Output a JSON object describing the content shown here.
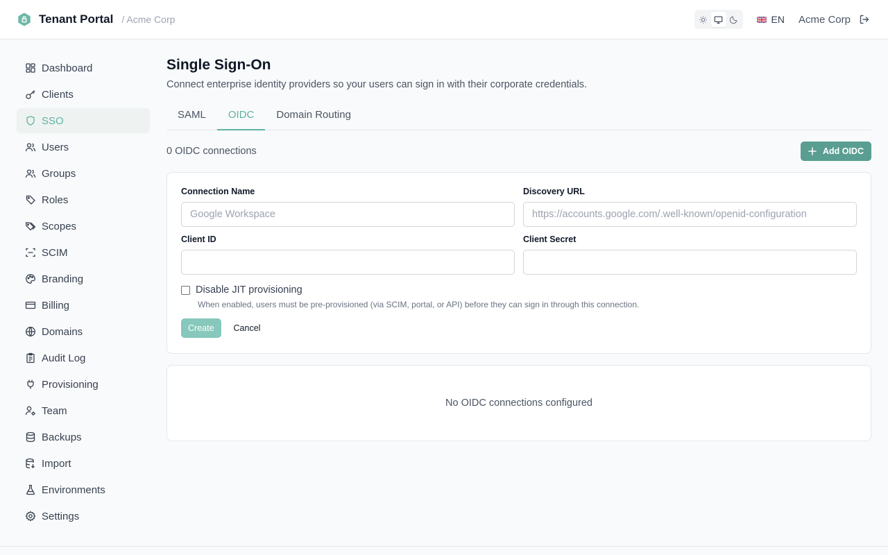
{
  "header": {
    "app_name": "Tenant Portal",
    "tenant_crumb": "/ Acme Corp",
    "language": "EN",
    "tenant_name": "Acme Corp",
    "accent": "#5fb3a3"
  },
  "sidebar": {
    "items": [
      {
        "label": "Dashboard",
        "icon": "dashboard-icon"
      },
      {
        "label": "Clients",
        "icon": "key-icon"
      },
      {
        "label": "SSO",
        "icon": "shield-icon",
        "active": true
      },
      {
        "label": "Users",
        "icon": "users-icon"
      },
      {
        "label": "Groups",
        "icon": "groups-icon"
      },
      {
        "label": "Roles",
        "icon": "tag-icon"
      },
      {
        "label": "Scopes",
        "icon": "tags-icon"
      },
      {
        "label": "SCIM",
        "icon": "scan-icon"
      },
      {
        "label": "Branding",
        "icon": "palette-icon"
      },
      {
        "label": "Billing",
        "icon": "credit-card-icon"
      },
      {
        "label": "Domains",
        "icon": "globe-icon"
      },
      {
        "label": "Audit Log",
        "icon": "clipboard-icon"
      },
      {
        "label": "Provisioning",
        "icon": "plug-icon"
      },
      {
        "label": "Team",
        "icon": "user-cog-icon"
      },
      {
        "label": "Backups",
        "icon": "database-icon"
      },
      {
        "label": "Import",
        "icon": "database-import-icon"
      },
      {
        "label": "Environments",
        "icon": "flask-icon"
      },
      {
        "label": "Settings",
        "icon": "gear-icon"
      }
    ]
  },
  "main": {
    "title": "Single Sign-On",
    "description": "Connect enterprise identity providers so your users can sign in with their corporate credentials.",
    "tabs": [
      {
        "label": "SAML"
      },
      {
        "label": "OIDC",
        "active": true
      },
      {
        "label": "Domain Routing"
      }
    ],
    "connection_count": "0 OIDC connections",
    "add_button": "Add OIDC",
    "form": {
      "name_label": "Connection Name",
      "name_placeholder": "Google Workspace",
      "name_value": "",
      "discovery_label": "Discovery URL",
      "discovery_placeholder": "https://accounts.google.com/.well-known/openid-configuration",
      "discovery_value": "",
      "client_id_label": "Client ID",
      "client_id_value": "",
      "client_secret_label": "Client Secret",
      "client_secret_value": "",
      "jit_label": "Disable JIT provisioning",
      "jit_checked": false,
      "jit_help": "When enabled, users must be pre-provisioned (via SCIM, portal, or API) before they can sign in through this connection.",
      "create_button": "Create",
      "cancel_button": "Cancel"
    },
    "empty_state": "No OIDC connections configured"
  }
}
